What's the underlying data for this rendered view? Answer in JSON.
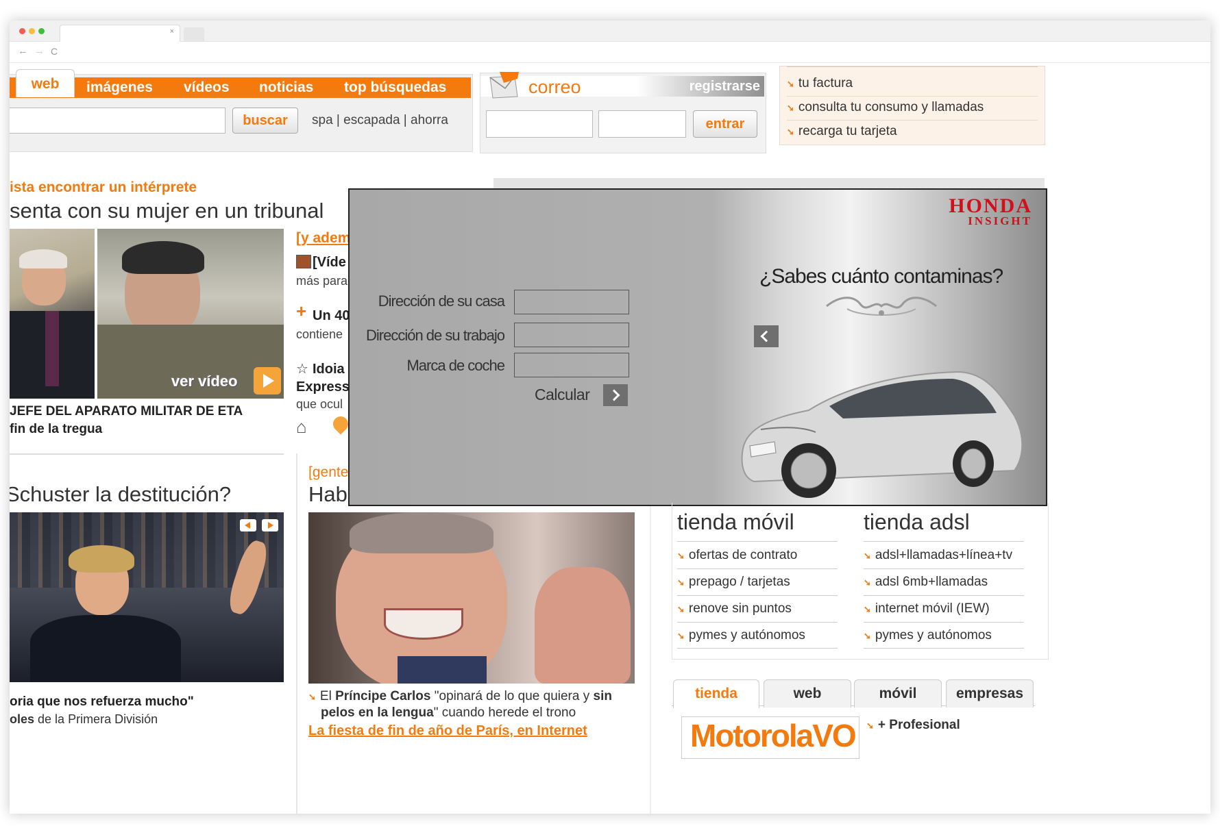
{
  "browser": {
    "tab_close": "×",
    "nav": {
      "back": "←",
      "forward": "→",
      "reload": "C"
    }
  },
  "search": {
    "tabs": [
      "web",
      "imágenes",
      "vídeos",
      "noticias",
      "top búsquedas"
    ],
    "button": "buscar",
    "suggestions": "spa | escapada | ahorra"
  },
  "mail": {
    "title": "correo",
    "register": "registrarse",
    "login_button": "entrar"
  },
  "account": {
    "items": [
      "tu factura",
      "consulta tu consumo y llamadas",
      "recarga tu tarjeta"
    ]
  },
  "news": {
    "story1": {
      "kicker": "ista encontrar un intérprete",
      "headline": "senta con su mujer en un tribunal",
      "video_label": "ver vídeo",
      "caption_line1": "JEFE DEL APARATO MILITAR DE ETA",
      "caption_line2": "fin de la tregua"
    },
    "side": {
      "more": "[y adem",
      "item1_title": "[Víde",
      "item1_text": "más para",
      "item2_title": "Un 40",
      "item2_text": "contiene",
      "item3_title": "Idoia",
      "item3_sub": "Express",
      "item3_text": "que ocul"
    },
    "story2": {
      "headline": "Schuster la destitución?",
      "caption_bold": "oria que nos refuerza mucho\"",
      "caption_line2_bold": "oles",
      "caption_line2_rest": " de la Primera División"
    },
    "story3": {
      "kicker": "[gente",
      "headline": "Hab",
      "caption_pre": "El ",
      "caption_bold1": "Príncipe Carlos",
      "caption_mid": " \"opinará de lo que quiera y ",
      "caption_bold2": "sin",
      "caption_line2_bold": "pelos en la lengua",
      "caption_line2_rest": "\" cuando herede el trono",
      "more_link": "La fiesta de fin de año de París, en Internet"
    }
  },
  "ad": {
    "brand_line1": "HONDA",
    "brand_line2": "INSIGHT",
    "question": "¿Sabes cuánto contaminas?",
    "fields": [
      "Dirección de su casa",
      "Dirección de su trabajo",
      "Marca de coche"
    ],
    "submit": "Calcular"
  },
  "shop": {
    "mobile": {
      "title": "tienda móvil",
      "items": [
        "ofertas de contrato",
        "prepago / tarjetas",
        "renove sin puntos",
        "pymes y autónomos"
      ]
    },
    "adsl": {
      "title": "tienda adsl",
      "items": [
        "adsl+llamadas+línea+tv",
        "adsl 6mb+llamadas",
        "internet móvil (IEW)",
        "pymes y autónomos"
      ]
    },
    "bottom_tabs": [
      "tienda",
      "web",
      "móvil",
      "empresas"
    ],
    "promo_logo": "MotorolaVO",
    "promo_link": "+ Profesional"
  },
  "colors": {
    "accent": "#f47a0e",
    "honda_red": "#d0101a"
  }
}
